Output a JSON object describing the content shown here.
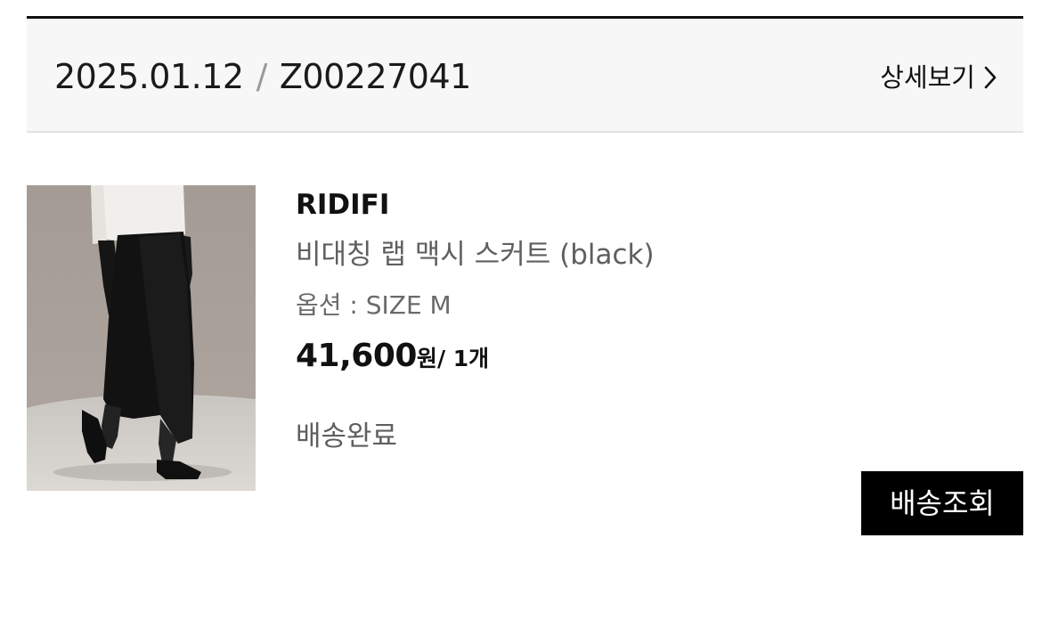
{
  "order": {
    "date": "2025.01.12",
    "separator": "/",
    "number": "Z00227041",
    "detail_label": "상세보기"
  },
  "product": {
    "brand": "RIDIFI",
    "name": "비대칭 랩 맥시 스커트 (black)",
    "option": "옵션 : SIZE M",
    "price": "41,600",
    "currency": "원",
    "quantity": "/ 1개",
    "status": "배송완료",
    "image_icon": "product-photo-skirt"
  },
  "actions": {
    "track_label": "배송조회"
  },
  "colors": {
    "accent": "#000000",
    "header_bg": "#f7f7f7",
    "muted_text": "#5f5f5f"
  }
}
